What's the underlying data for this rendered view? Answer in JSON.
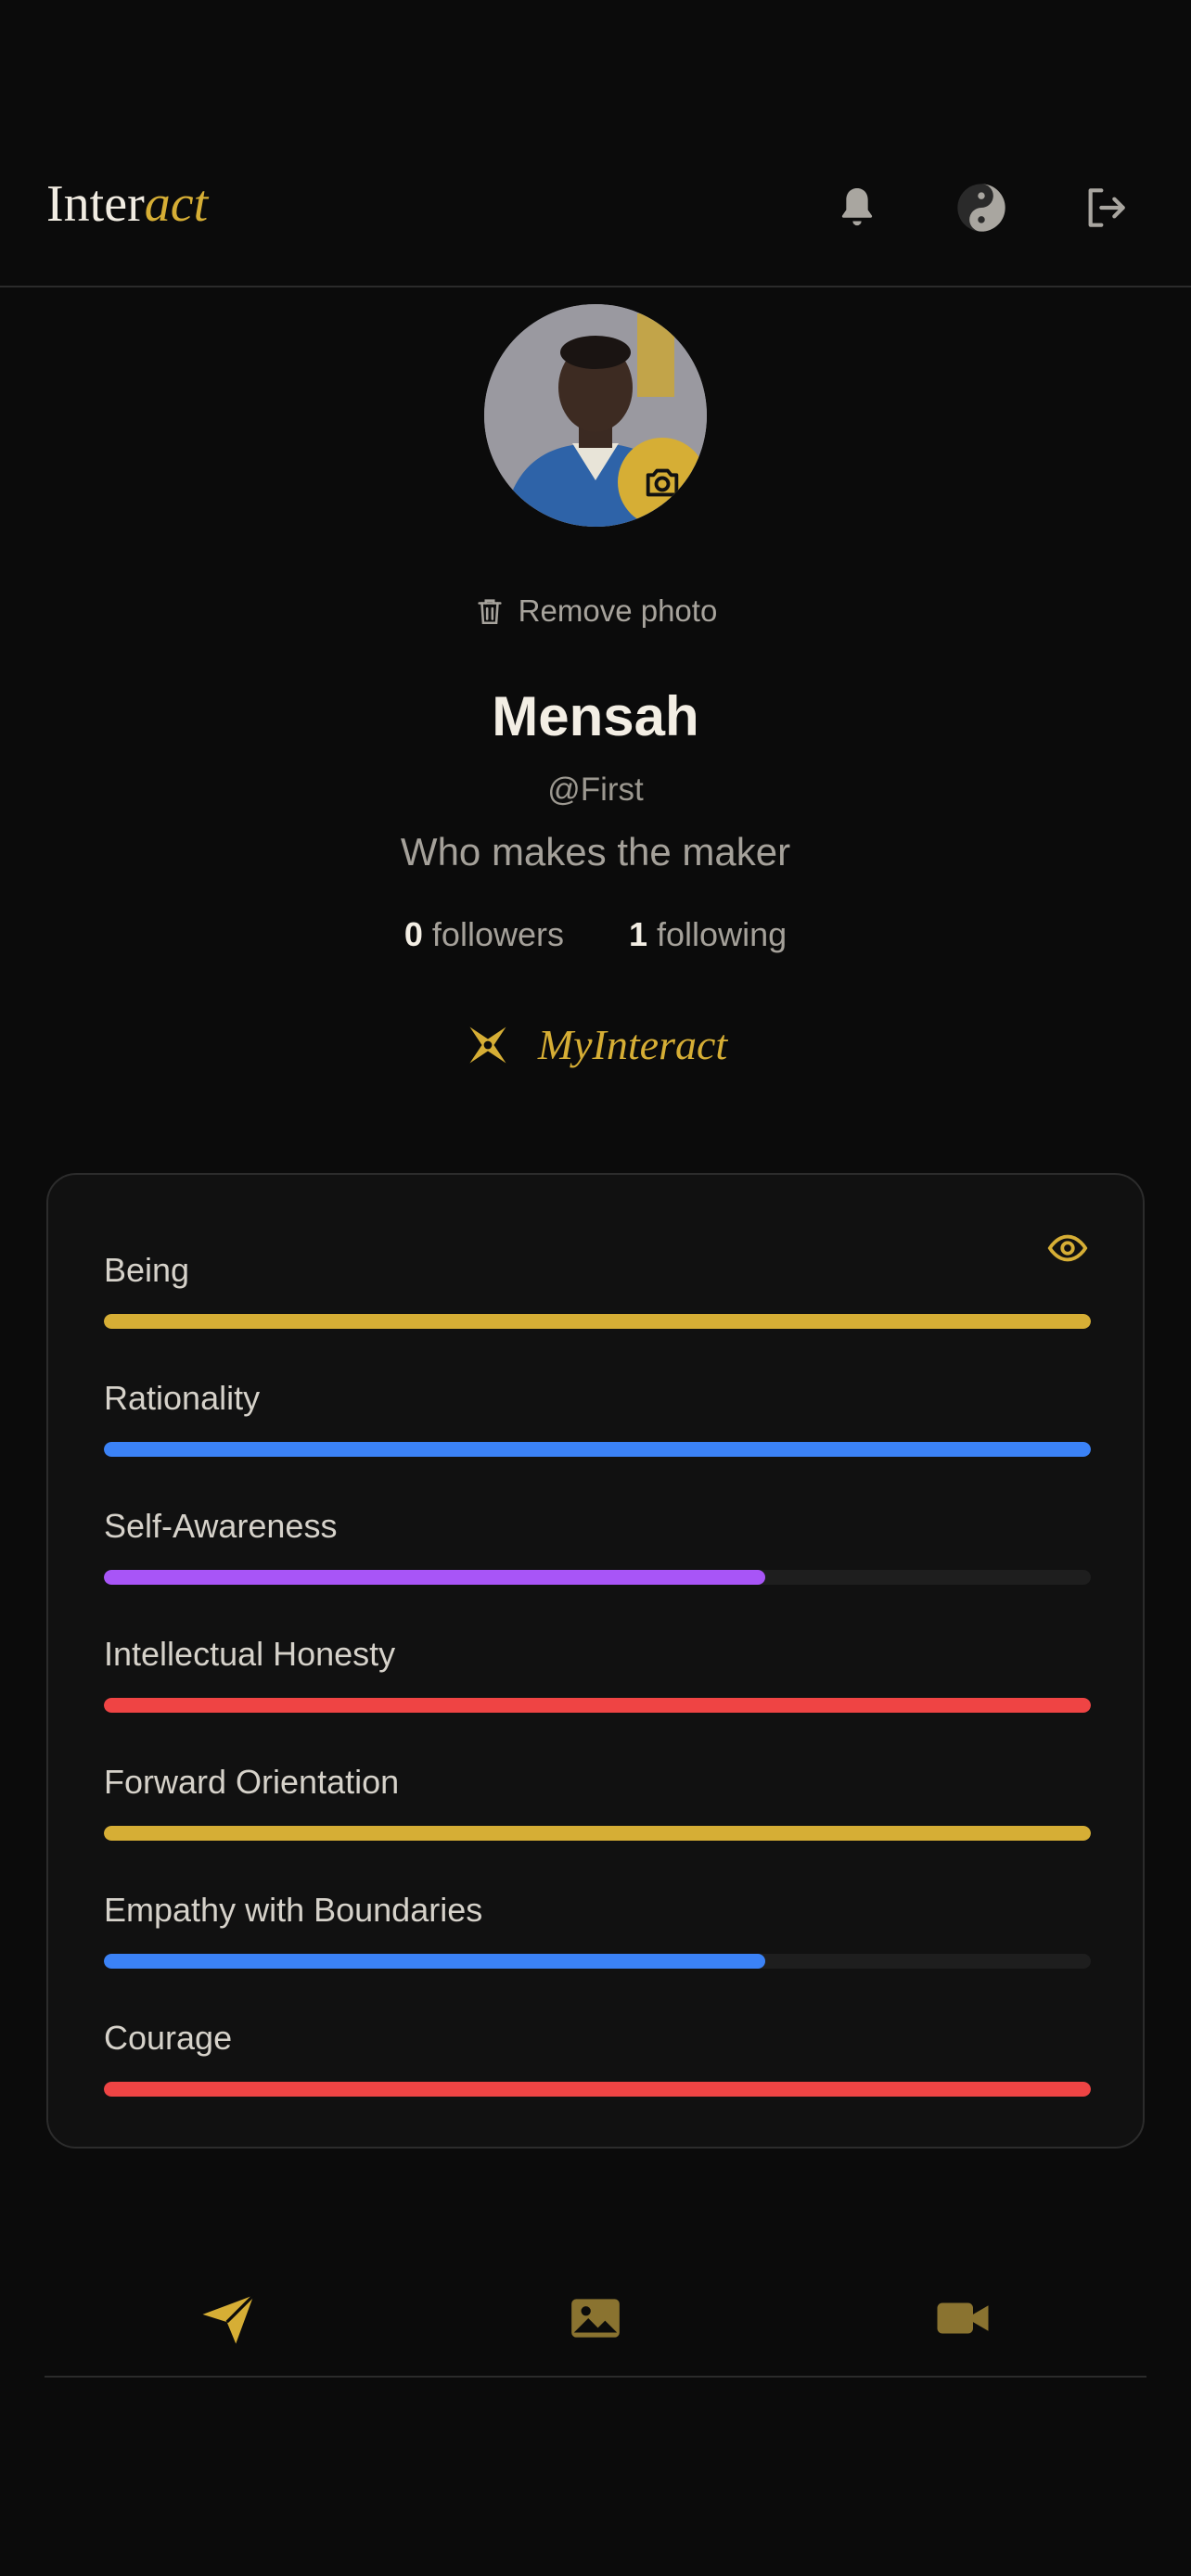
{
  "app": {
    "logo_part1": "Inter",
    "logo_part2": "act"
  },
  "header": {
    "icons": [
      "bell-icon",
      "yin-yang-icon",
      "logout-icon"
    ]
  },
  "profile": {
    "remove_photo_label": "Remove photo",
    "name": "Mensah",
    "handle": "@First",
    "bio": "Who makes the maker",
    "followers_count": "0",
    "followers_label": "followers",
    "following_count": "1",
    "following_label": "following",
    "my_interact_label": "MyInteract"
  },
  "traits": [
    {
      "label": "Being",
      "progress": 1.0,
      "color": "#d6ae35"
    },
    {
      "label": "Rationality",
      "progress": 1.0,
      "color": "#3b82f6"
    },
    {
      "label": "Self-Awareness",
      "progress": 0.67,
      "color": "#a855f7"
    },
    {
      "label": "Intellectual Honesty",
      "progress": 1.0,
      "color": "#ef4444"
    },
    {
      "label": "Forward Orientation",
      "progress": 1.0,
      "color": "#d6ae35"
    },
    {
      "label": "Empathy with Boundaries",
      "progress": 0.67,
      "color": "#3b82f6"
    },
    {
      "label": "Courage",
      "progress": 1.0,
      "color": "#ef4444"
    }
  ],
  "colors": {
    "accent": "#d6ae35",
    "accent_dim": "#8a7330",
    "background": "#0b0b0b",
    "card": "#111111"
  },
  "bottom_nav": {
    "items": [
      "send-icon",
      "image-icon",
      "video-icon"
    ]
  }
}
